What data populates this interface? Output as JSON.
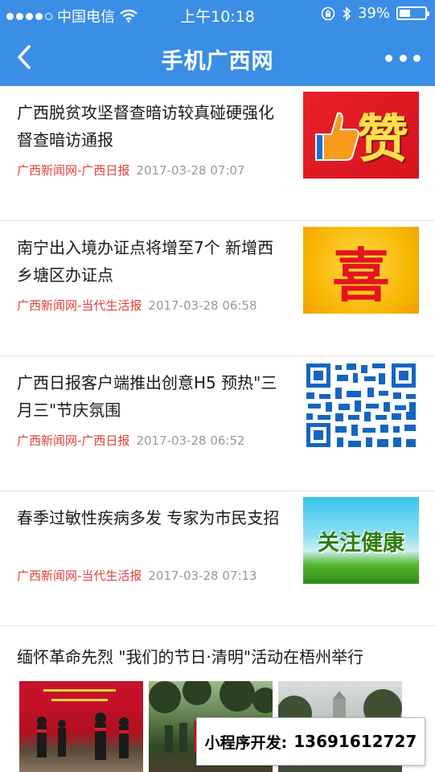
{
  "status_bar": {
    "carrier": "中国电信",
    "time": "上午10:18",
    "battery": "39%"
  },
  "nav": {
    "title": "手机广西网"
  },
  "news": [
    {
      "title": "广西脱贫攻坚督查暗访较真碰硬强化督查暗访通报",
      "source": "广西新闻网-广西日报",
      "time": "2017-03-28 07:07",
      "thumb_text": "赞"
    },
    {
      "title": "南宁出入境办证点将增至7个 新增西乡塘区办证点",
      "source": "广西新闻网-当代生活报",
      "time": "2017-03-28 06:58",
      "thumb_text": "喜"
    },
    {
      "title": "广西日报客户端推出创意H5 预热\"三月三\"节庆氛围",
      "source": "广西新闻网-广西日报",
      "time": "2017-03-28 06:52",
      "thumb_text": ""
    },
    {
      "title": "春季过敏性疾病多发 专家为市民支招",
      "source": "广西新闻网-当代生活报",
      "time": "2017-03-28 07:13",
      "thumb_text": "关注健康"
    }
  ],
  "photo_news": {
    "title": "缅怀革命先烈 \"我们的节日·清明\"活动在梧州举行"
  },
  "promo": {
    "label": "小程序开发:",
    "number": "13691612727"
  },
  "colors": {
    "header": "#3a8ee6",
    "source": "#e0403a",
    "meta_time": "#999999"
  }
}
